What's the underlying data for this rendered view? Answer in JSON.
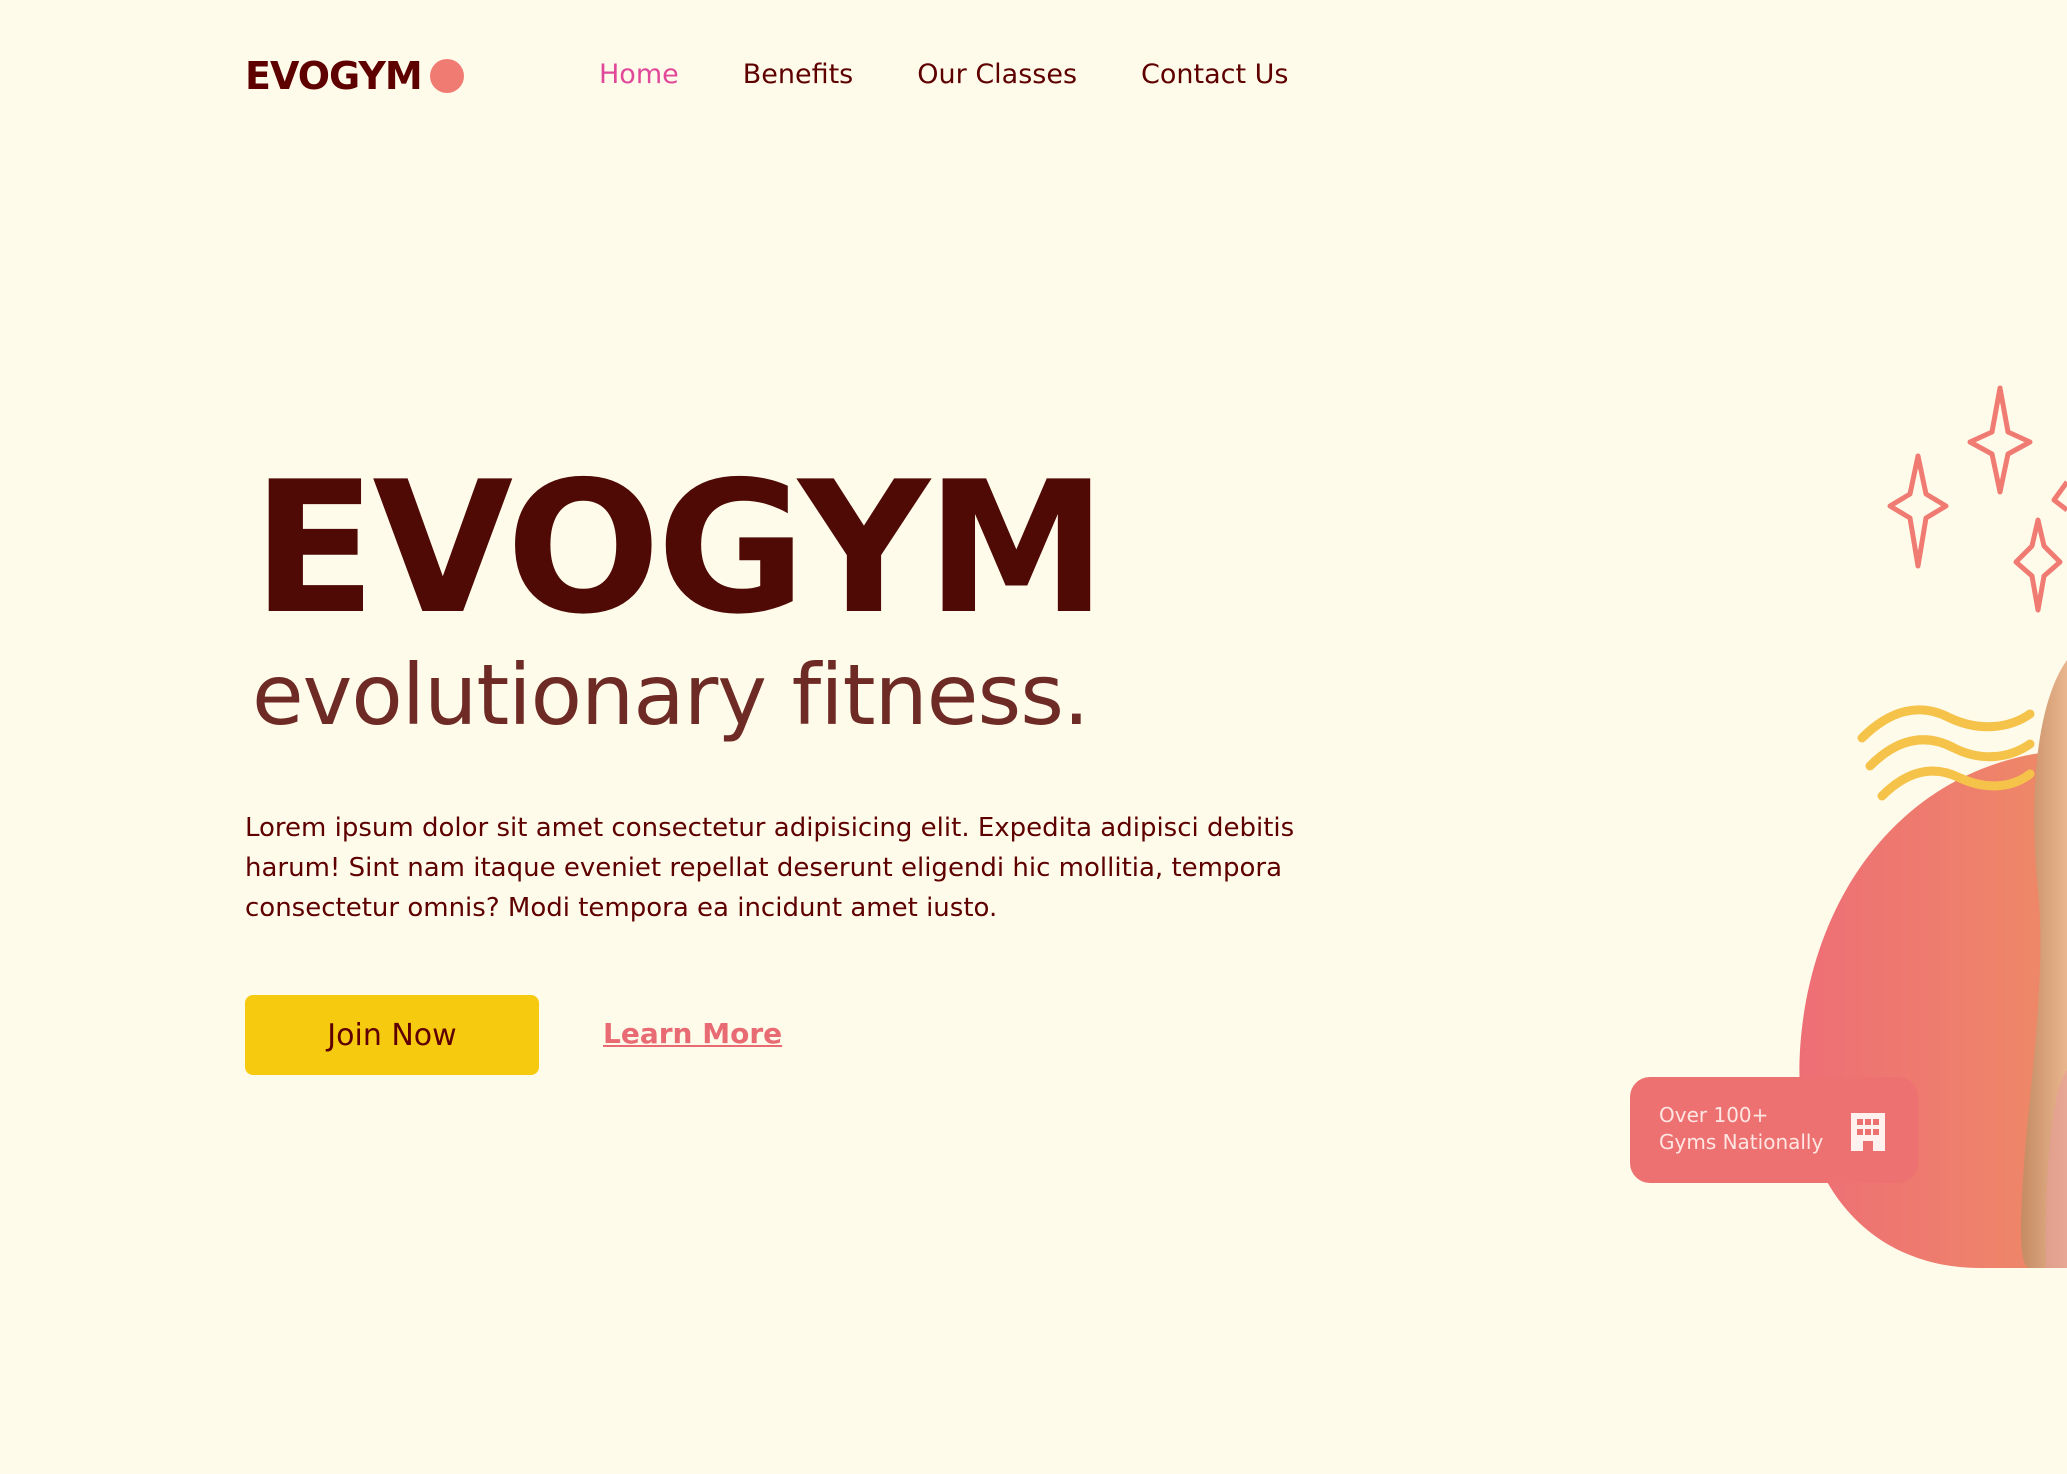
{
  "brand": {
    "logo_text": "EVOGYM",
    "accent_color": "#F07B72",
    "primary_text_color": "#5E0000",
    "background_color": "#FFFBEB"
  },
  "nav": {
    "items": [
      {
        "label": "Home",
        "active": true
      },
      {
        "label": "Benefits",
        "active": false
      },
      {
        "label": "Our Classes",
        "active": false
      },
      {
        "label": "Contact Us",
        "active": false
      }
    ],
    "active_color": "#E0499A"
  },
  "hero": {
    "title": "EVOGYM",
    "subtitle": "evolutionary fitness.",
    "description": "Lorem ipsum dolor sit amet consectetur adipisicing elit. Expedita adipisci debitis harum! Sint nam itaque eveniet repellat deserunt eligendi hic mollitia, tempora consectetur omnis? Modi tempora ea incidunt amet iusto.",
    "primary_button": "Join Now",
    "primary_button_color": "#F6CB0F",
    "secondary_link": "Learn More",
    "secondary_link_color": "#E86B73"
  },
  "badge": {
    "line1": "Over 100+",
    "line2": "Gyms Nationally",
    "icon": "building-icon",
    "color": "#EC7170"
  },
  "decorations": {
    "sparkles_icon": "sparkles-icon",
    "wave_icon": "wave-lines-icon",
    "sparkle_color": "#F07B72",
    "wave_color": "#F6C34A"
  }
}
